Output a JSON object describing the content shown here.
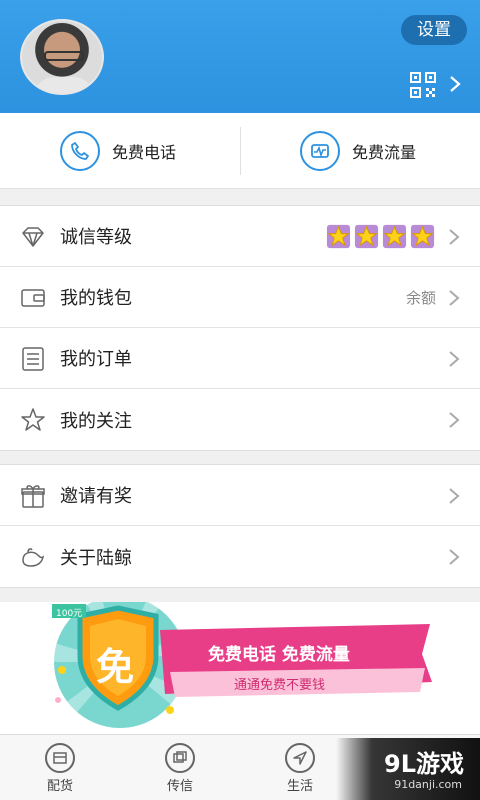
{
  "header": {
    "settings_label": "设置",
    "accent_color": "#2d92df"
  },
  "quick": {
    "call_label": "免费电话",
    "traffic_label": "免费流量"
  },
  "menu": {
    "credit": {
      "label": "诚信等级",
      "stars": 4
    },
    "wallet": {
      "label": "我的钱包",
      "extra": "余额"
    },
    "orders": {
      "label": "我的订单"
    },
    "follow": {
      "label": "我的关注"
    },
    "invite": {
      "label": "邀请有奖"
    },
    "about": {
      "label": "关于陆鲸"
    }
  },
  "banner": {
    "badge": "免",
    "corner": "100元",
    "title": "免费电话 免费流量",
    "subtitle": "通通免费不要钱"
  },
  "tabs": [
    {
      "label": "配货",
      "icon": "cargo-icon"
    },
    {
      "label": "传信",
      "icon": "message-icon"
    },
    {
      "label": "生活",
      "icon": "navigate-icon"
    }
  ],
  "watermark": {
    "title": "9L游戏",
    "sub": "91danji.com"
  }
}
